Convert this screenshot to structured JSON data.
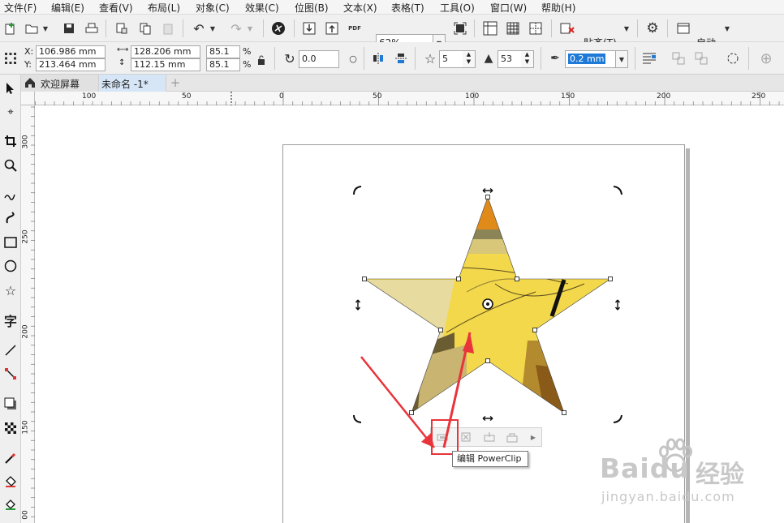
{
  "menu": [
    "文件(F)",
    "编辑(E)",
    "查看(V)",
    "布局(L)",
    "对象(C)",
    "效果(C)",
    "位图(B)",
    "文本(X)",
    "表格(T)",
    "工具(O)",
    "窗口(W)",
    "帮助(H)"
  ],
  "toolbar1": {
    "zoom": "62%",
    "snap_label": "贴齐(T)",
    "launch_label": "启动"
  },
  "property_bar": {
    "x": "106.986 mm",
    "y": "213.464 mm",
    "x_label": "X:",
    "y_label": "Y:",
    "width": "128.206 mm",
    "height": "112.15 mm",
    "scale_x": "85.1",
    "scale_y": "85.1",
    "percent": "%",
    "rotation": "0.0",
    "points": "5",
    "sharpness": "53",
    "outline_width": "0.2 mm"
  },
  "tabs": {
    "welcome": "欢迎屏幕",
    "document": "未命名 -1*"
  },
  "ruler": {
    "h": [
      "100",
      "50",
      "0",
      "50",
      "100",
      "150",
      "200",
      "250"
    ],
    "v": [
      "300",
      "250",
      "200",
      "150",
      "00"
    ]
  },
  "tooltip": "编辑 PowerClip",
  "watermark": {
    "brand": "Baidu",
    "cn": "经验",
    "url": "jingyan.baidu.com"
  },
  "colors": {
    "accent": "#1e7ad6",
    "star_yellow": "#f2d84a",
    "arrow_red": "#e8343a",
    "highlight_box": "#e8343a"
  }
}
